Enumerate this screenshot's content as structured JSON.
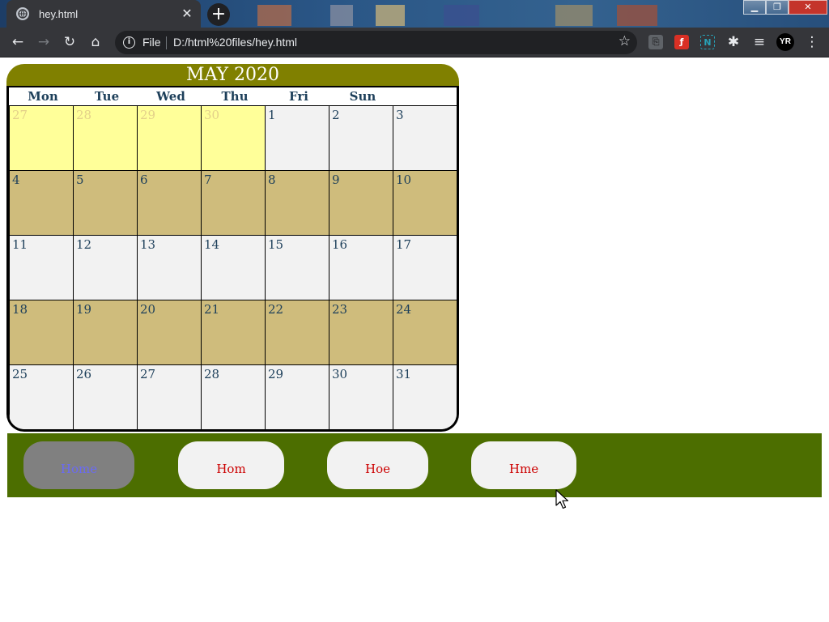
{
  "browser": {
    "tab_title": "hey.html",
    "tab_close": "✕",
    "new_tab": "+",
    "scheme_label": "File",
    "url": "D:/html%20files/hey.html",
    "avatar_initials": "YR",
    "window_controls": {
      "minimize": "▁",
      "maximize": "❐",
      "close": "✕"
    },
    "toolbar_icons": [
      "back-icon",
      "forward-icon",
      "reload-icon",
      "home-icon",
      "info-icon",
      "star-icon",
      "pdf-icon",
      "flash-icon",
      "extension-n-icon",
      "puzzle-icon",
      "media-queue-icon",
      "menu-icon"
    ]
  },
  "calendar": {
    "title": "MAY 2020",
    "weekdays": [
      "Mon",
      "Tue",
      "Wed",
      "Thu",
      "Fri",
      "Sun"
    ],
    "weeks": [
      [
        "27",
        "28",
        "29",
        "30",
        "1",
        "2",
        "3"
      ],
      [
        "4",
        "5",
        "6",
        "7",
        "8",
        "9",
        "10"
      ],
      [
        "11",
        "12",
        "13",
        "14",
        "15",
        "16",
        "17"
      ],
      [
        "18",
        "19",
        "20",
        "21",
        "22",
        "23",
        "24"
      ],
      [
        "25",
        "26",
        "27",
        "28",
        "29",
        "30",
        "31"
      ]
    ],
    "colors": {
      "header": "#808000",
      "prev_month": "#ffff99",
      "light_row": "#f2f2f2",
      "tan_row": "#cfbc7c",
      "day_text": "#1d3f5a"
    }
  },
  "nav": {
    "items": [
      {
        "label": "Home",
        "active": true
      },
      {
        "label": "Hom",
        "active": false
      },
      {
        "label": "Hoe",
        "active": false
      },
      {
        "label": "Hme",
        "active": false
      }
    ],
    "colors": {
      "bar": "#4c6e00",
      "button": "#f2f2f2",
      "active_button": "#808080",
      "label": "#cc0000",
      "active_label": "#6a6af5"
    }
  }
}
